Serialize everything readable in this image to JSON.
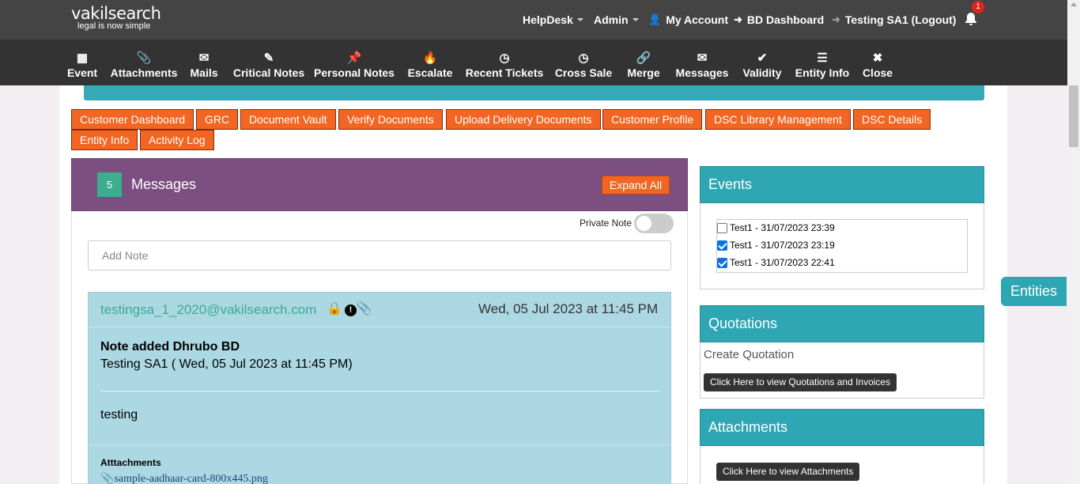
{
  "logo": {
    "name": "vakilsearch",
    "tagline": "legal is now simple"
  },
  "topnav": {
    "helpdesk": "HelpDesk",
    "admin": "Admin",
    "my_account": "My Account",
    "bd_dashboard": "BD Dashboard",
    "logout": "Testing SA1 (Logout)",
    "notification_count": "1"
  },
  "toolbar": [
    {
      "label": "Event",
      "icon": "calendar-icon",
      "glyph": "▦"
    },
    {
      "label": "Attachments",
      "icon": "paperclip-icon",
      "glyph": "📎"
    },
    {
      "label": "Mails",
      "icon": "envelope-icon",
      "glyph": "✉"
    },
    {
      "label": "Critical Notes",
      "icon": "pencil-icon",
      "glyph": "✎"
    },
    {
      "label": "Personal Notes",
      "icon": "pin-icon",
      "glyph": "📌"
    },
    {
      "label": "Escalate",
      "icon": "fire-icon",
      "glyph": "🔥"
    },
    {
      "label": "Recent Tickets",
      "icon": "clock-icon",
      "glyph": "◷"
    },
    {
      "label": "Cross Sale",
      "icon": "clock-icon",
      "glyph": "◷"
    },
    {
      "label": "Merge",
      "icon": "link-icon",
      "glyph": "🔗"
    },
    {
      "label": "Messages",
      "icon": "envelope-icon",
      "glyph": "✉"
    },
    {
      "label": "Validity",
      "icon": "check-icon",
      "glyph": "✔"
    },
    {
      "label": "Entity Info",
      "icon": "list-icon",
      "glyph": "☰"
    },
    {
      "label": "Close",
      "icon": "close-icon",
      "glyph": "✖"
    }
  ],
  "action_buttons": [
    "Customer Dashboard",
    "GRC",
    "Document Vault",
    "Verify Documents",
    "Upload Delivery Documents",
    "Customer Profile",
    "DSC Library Management",
    "DSC Details",
    "Entity Info",
    "Activity Log"
  ],
  "messages": {
    "count": "5",
    "title": "Messages",
    "expand_all": "Expand All",
    "private_note_label": "Private Note",
    "private_note_on": false,
    "add_note_placeholder": "Add Note",
    "note": {
      "email": "testingsa_1_2020@vakilsearch.com",
      "date": "Wed, 05 Jul 2023 at 11:45 PM",
      "title": "Note added Dhrubo BD",
      "subtitle": "Testing SA1 ( Wed, 05 Jul 2023 at 11:45 PM)",
      "body": "testing",
      "attachments_label": "Atttachments",
      "file": "sample-aadhaar-card-800x445.png"
    }
  },
  "events": {
    "title": "Events",
    "items": [
      {
        "label": "Test1 - 31/07/2023 23:39",
        "checked": false
      },
      {
        "label": "Test1 - 31/07/2023 23:19",
        "checked": true
      },
      {
        "label": "Test1 - 31/07/2023 22:41",
        "checked": true
      }
    ]
  },
  "quotations": {
    "title": "Quotations",
    "create": "Create Quotation",
    "view_button": "Click Here to view Quotations and Invoices"
  },
  "attachments": {
    "title": "Attachments",
    "view_button": "Click Here to view Attachments"
  },
  "entities_tab": "Entities",
  "colors": {
    "teal": "#2ea6b3",
    "orange": "#f26522",
    "purple": "#7b4f80",
    "note_bg": "#acd8e4"
  }
}
